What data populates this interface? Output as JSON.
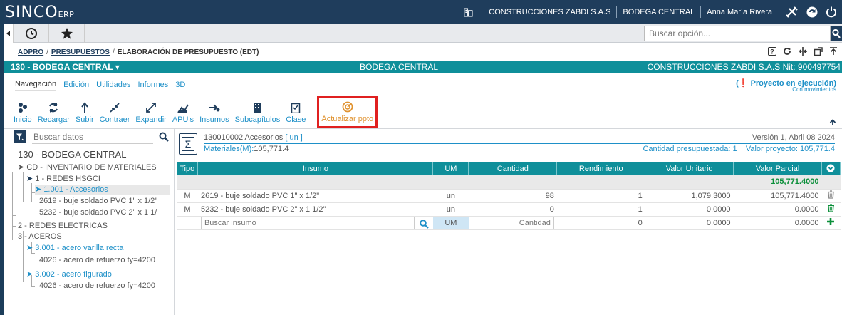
{
  "app": {
    "logo": "SINCO",
    "logo_suffix": "ERP",
    "company": "CONSTRUCCIONES ZABDI S.A.S",
    "warehouse": "BODEGA CENTRAL",
    "user": "Anna María Rivera"
  },
  "nav": {
    "search_placeholder": "Buscar opción..."
  },
  "breadcrumb": {
    "items": [
      "ADPRO",
      "PRESUPUESTOS"
    ],
    "current": "ELABORACIÓN DE PRESUPUESTO (EDT)"
  },
  "context_bar": {
    "left": "130 - BODEGA CENTRAL ▾",
    "center": "BODEGA CENTRAL",
    "right": "CONSTRUCCIONES ZABDI S.A.S Nit: 900497754"
  },
  "tabs": [
    "Navegación",
    "Edición",
    "Utilidades",
    "Informes",
    "3D"
  ],
  "project_status": {
    "label": "Proyecto en ejecución",
    "sub": "Con movimientos"
  },
  "toolbar": {
    "inicio": "Inicio",
    "recargar": "Recargar",
    "subir": "Subir",
    "contraer": "Contraer",
    "expandir": "Expandir",
    "apus": "APU's",
    "insumos": "Insumos",
    "subcapitulos": "Subcapítulos",
    "clase": "Clase",
    "actualizar": "Actualizar ppto"
  },
  "left": {
    "filter_placeholder": "Buscar datos",
    "title": "130 - BODEGA CENTRAL",
    "tree": {
      "n0": "CD - INVENTARIO DE MATERIALES",
      "n1": "1 - REDES HSGCI",
      "n2": "1.001 - Accesorios",
      "n3": "2619 - buje soldado PVC 1\" x 1/2\"",
      "n4": "5232 - buje soldado PVC 2\" x 1 1/",
      "n5": "2 - REDES ELECTRICAS",
      "n6": "3 - ACEROS",
      "n7": "3.001 - acero varilla recta",
      "n8": "4026 - acero de refuerzo fy=4200",
      "n9": "3.002 - acero figurado",
      "n10": "4026 - acero de refuerzo fy=4200"
    }
  },
  "item": {
    "code": "130010002 Accesorios",
    "unit": "[ un ]",
    "version": "Versión 1, Abril 08 2024",
    "materials": "Materiales(M):",
    "materials_value": "105,771.4",
    "qty_label": "Cantidad presupuestada: 1",
    "value_label": "Valor proyecto: 105,771.4"
  },
  "grid": {
    "headers": [
      "Tipo",
      "Insumo",
      "UM",
      "Cantidad",
      "Rendimiento",
      "Valor Unitario",
      "Valor Parcial"
    ],
    "total": "105,771.4000",
    "rows": [
      {
        "tipo": "M",
        "insumo": "2619 - buje soldado PVC 1\" x 1/2\"",
        "um": "un",
        "cantidad": "98",
        "rendimiento": "1",
        "unitario": "1,079.3000",
        "parcial": "105,771.4000"
      },
      {
        "tipo": "M",
        "insumo": "5232 - buje soldado PVC 2\" x 1 1/2\"",
        "um": "un",
        "cantidad": "0",
        "rendimiento": "1",
        "unitario": "0.0000",
        "parcial": "0.0000"
      }
    ],
    "new_row": {
      "insumo_placeholder": "Buscar insumo",
      "um": "UM",
      "cantidad_placeholder": "Cantidad",
      "rendimiento": "0",
      "unitario": "0.0000",
      "parcial": "0.0000"
    }
  }
}
